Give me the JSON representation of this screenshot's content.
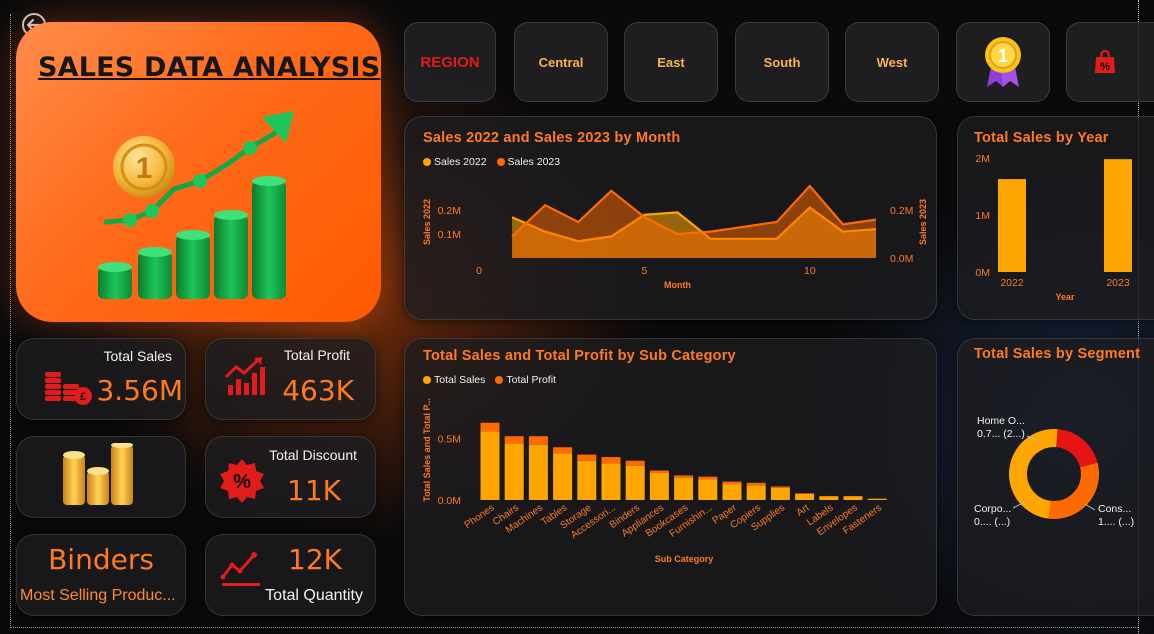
{
  "header": {
    "title": "SALES DATA ANALYSIS",
    "slicer_label": "REGION",
    "regions": [
      "Central",
      "East",
      "South",
      "West"
    ]
  },
  "icons": {
    "back": "back-arrow-icon",
    "medal": "medal-icon",
    "bag": "discount-bag-icon",
    "coins": "coins-icon",
    "growth": "growth-chart-icon"
  },
  "kpis": {
    "total_sales": {
      "label": "Total Sales",
      "value": "3.56M"
    },
    "total_profit": {
      "label": "Total Profit",
      "value": "463K"
    },
    "total_discount": {
      "label": "Total Discount",
      "value": "11K"
    },
    "total_quantity": {
      "label": "Total Quantity",
      "value": "12K"
    },
    "best_seller": {
      "label": "Most Selling Produc...",
      "value": "Binders"
    }
  },
  "colors": {
    "accent": "#ff7a1f",
    "series_a": "#ffa500",
    "series_b": "#ff6a00",
    "red": "#e21b1b"
  },
  "chart_data": [
    {
      "id": "monthly",
      "type": "area",
      "title": "Sales 2022 and Sales 2023 by Month",
      "xlabel": "Month",
      "ylabel_left": "Sales 2022",
      "ylabel_right": "Sales 2023",
      "x": [
        1,
        2,
        3,
        4,
        5,
        6,
        7,
        8,
        9,
        10,
        11,
        12
      ],
      "xticks": [
        0,
        5,
        10
      ],
      "xlim": [
        0,
        12
      ],
      "series": [
        {
          "name": "Sales 2022",
          "color": "#ffa500",
          "axis": "left",
          "ylim": [
            0,
            0.3
          ],
          "yticks": [
            {
              "v": 0.1,
              "t": "0.1M"
            },
            {
              "v": 0.2,
              "t": "0.2M"
            }
          ],
          "values": [
            0.17,
            0.11,
            0.07,
            0.09,
            0.18,
            0.19,
            0.08,
            0.08,
            0.08,
            0.21,
            0.11,
            0.12
          ]
        },
        {
          "name": "Sales 2023",
          "color": "#ff6a00",
          "axis": "right",
          "ylim": [
            0,
            0.3
          ],
          "yticks": [
            {
              "v": 0,
              "t": "0.0M"
            },
            {
              "v": 0.2,
              "t": "0.2M"
            }
          ],
          "values": [
            0.09,
            0.22,
            0.15,
            0.28,
            0.17,
            0.1,
            0.11,
            0.13,
            0.15,
            0.3,
            0.14,
            0.16
          ]
        }
      ]
    },
    {
      "id": "yearly",
      "type": "bar",
      "title": "Total Sales by Year",
      "xlabel": "Year",
      "categories": [
        "2022",
        "2023"
      ],
      "values": [
        1.63,
        1.98
      ],
      "ylim": [
        0,
        2
      ],
      "yticks": [
        {
          "v": 0,
          "t": "0M"
        },
        {
          "v": 1,
          "t": "1M"
        },
        {
          "v": 2,
          "t": "2M"
        }
      ],
      "color": "#ffa500"
    },
    {
      "id": "subcategory",
      "type": "bar",
      "title": "Total Sales and Total Profit by Sub Category",
      "xlabel": "Sub Category",
      "ylabel": "Total Sales and Total P...",
      "categories": [
        "Phones",
        "Chairs",
        "Machines",
        "Tables",
        "Storage",
        "Accessori...",
        "Binders",
        "Appliances",
        "Bookcases",
        "Furnishin...",
        "Paper",
        "Copiers",
        "Supplies",
        "Art",
        "Labels",
        "Envelopes",
        "Fasteners"
      ],
      "ylim": [
        0,
        0.75
      ],
      "yticks": [
        {
          "v": 0,
          "t": "0.0M"
        },
        {
          "v": 0.5,
          "t": "0.5M"
        }
      ],
      "series": [
        {
          "name": "Total Sales",
          "color": "#ffa500",
          "values": [
            0.56,
            0.46,
            0.45,
            0.38,
            0.32,
            0.3,
            0.28,
            0.22,
            0.18,
            0.17,
            0.13,
            0.12,
            0.1,
            0.05,
            0.03,
            0.03,
            0.01
          ]
        },
        {
          "name": "Total Profit",
          "color": "#ff6a00",
          "values": [
            0.07,
            0.06,
            0.07,
            0.05,
            0.05,
            0.05,
            0.04,
            0.02,
            0.02,
            0.02,
            0.02,
            0.02,
            0.01,
            0.005,
            0.003,
            0.003,
            0.002
          ]
        }
      ]
    },
    {
      "id": "segment",
      "type": "pie",
      "title": "Total Sales by Segment",
      "labels": [
        "Home O...",
        "Corpo...",
        "Cons..."
      ],
      "sublabels": [
        "0.7... (2...)",
        "0.... (...)",
        "1.... (...)"
      ],
      "values": [
        0.7,
        1.1,
        1.76
      ],
      "colors": [
        "#e81414",
        "#ff6a00",
        "#ffa500"
      ]
    }
  ]
}
